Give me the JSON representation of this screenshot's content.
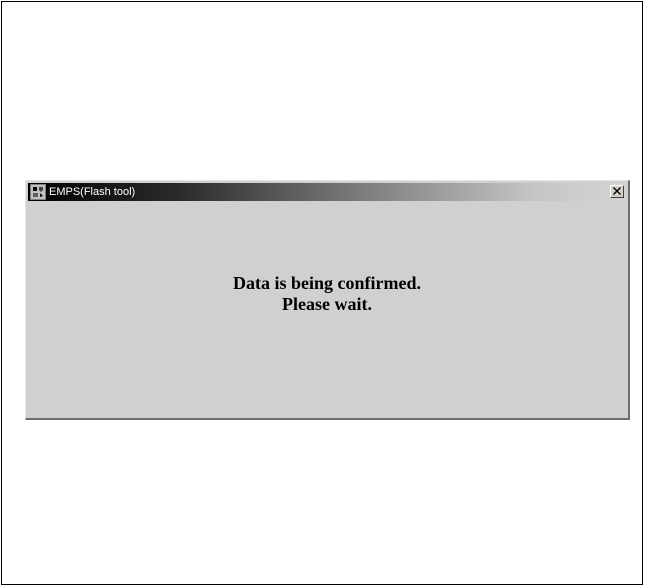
{
  "window": {
    "title": "EMPS(Flash tool)",
    "app_icon": "emps-app-icon",
    "close_icon": "close-x-icon"
  },
  "message": {
    "line1": "Data is being confirmed.",
    "line2": "Please wait."
  }
}
